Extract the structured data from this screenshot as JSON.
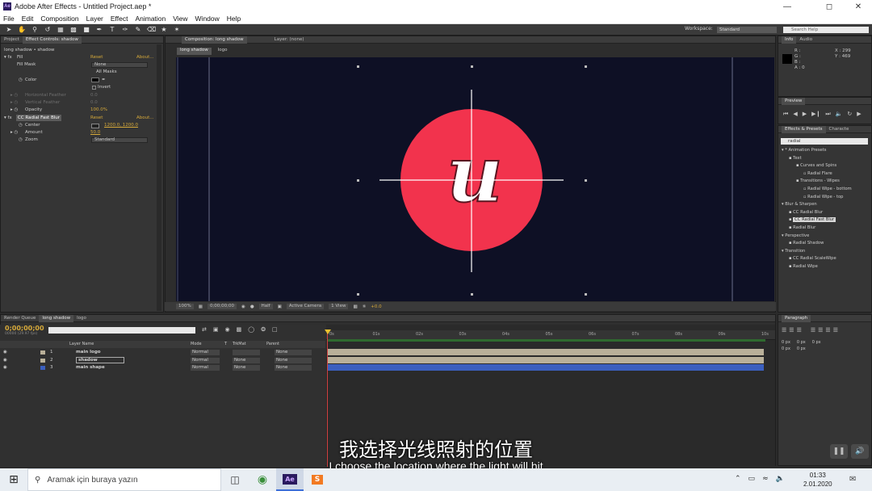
{
  "window": {
    "title": "Adobe After Effects - Untitled Project.aep *",
    "app_badge": "Ae"
  },
  "menu": [
    "File",
    "Edit",
    "Composition",
    "Layer",
    "Effect",
    "Animation",
    "View",
    "Window",
    "Help"
  ],
  "toolbar": {
    "workspace_label": "Workspace:",
    "workspace_value": "Standard",
    "search_placeholder": "Search Help"
  },
  "effect_controls": {
    "tabs": [
      "Project",
      "Effect Controls: shadow"
    ],
    "layer_path": "long shadow • shadow",
    "rows": [
      {
        "name": "Fill",
        "value": "Reset",
        "about": "About..."
      },
      {
        "name": "Fill Mask",
        "dropdown": "None"
      },
      {
        "name": "",
        "option": "All Masks"
      },
      {
        "name": "Color",
        "value": ""
      },
      {
        "name": "",
        "option": "Invert"
      },
      {
        "name": "Horizontal Feather",
        "value": "0.0"
      },
      {
        "name": "Vertical Feather",
        "value": "0.0"
      },
      {
        "name": "Opacity",
        "value": "100.0%"
      },
      {
        "name": "CC Radial Fast Blur",
        "value": "Reset",
        "about": "About..."
      },
      {
        "name": "Center",
        "value": "1200.0, 1200.0"
      },
      {
        "name": "Amount",
        "value": "50.0"
      },
      {
        "name": "Zoom",
        "dropdown": "Standard"
      }
    ]
  },
  "composition": {
    "tabs": [
      "Composition: long shadow",
      "Layer: (none)"
    ],
    "breadcrumbs": [
      "long shadow",
      "logo"
    ],
    "logo_letter": "u",
    "bottom": {
      "zoom": "100%",
      "timecode": "0;00;00;00",
      "resolution": "Half",
      "camera": "Active Camera",
      "view": "1 View",
      "exposure": "+0.0"
    }
  },
  "info": {
    "tabs": [
      "Info",
      "Audio"
    ],
    "r": "R :",
    "g": "G :",
    "b": "B :",
    "a": "A : 0",
    "x": "X : 299",
    "y": "Y : 469"
  },
  "preview": {
    "tab": "Preview"
  },
  "effects_presets": {
    "tabs": [
      "Effects & Presets",
      "Characte"
    ],
    "search_value": "radial",
    "tree": [
      {
        "label": "* Animation Presets",
        "indent": 0
      },
      {
        "label": "Text",
        "indent": 1
      },
      {
        "label": "Curves and Spins",
        "indent": 2
      },
      {
        "label": "Radial Flare",
        "indent": 3
      },
      {
        "label": "Transitions - Wipes",
        "indent": 2
      },
      {
        "label": "Radial Wipe - bottom",
        "indent": 3
      },
      {
        "label": "Radial Wipe - top",
        "indent": 3
      },
      {
        "label": "Blur & Sharpen",
        "indent": 0
      },
      {
        "label": "CC Radial Blur",
        "indent": 1
      },
      {
        "label": "CC Radial Fast Blur",
        "indent": 1,
        "selected": true
      },
      {
        "label": "Radial Blur",
        "indent": 1
      },
      {
        "label": "Perspective",
        "indent": 0
      },
      {
        "label": "Radial Shadow",
        "indent": 1
      },
      {
        "label": "Transition",
        "indent": 0
      },
      {
        "label": "CC Radial ScaleWipe",
        "indent": 1
      },
      {
        "label": "Radial Wipe",
        "indent": 1
      }
    ]
  },
  "timeline": {
    "tabs": [
      "Render Queue",
      "long shadow",
      "logo"
    ],
    "timecode": "0;00;00;00",
    "timecode_sub": "00000 (29.97 fps)",
    "columns": [
      "Layer Name",
      "Mode",
      "T",
      "TrkMat",
      "Parent"
    ],
    "layers": [
      {
        "num": "1",
        "name": "main logo",
        "mode": "Normal",
        "trkmat": "",
        "parent": "None",
        "color": "#b9b099"
      },
      {
        "num": "2",
        "name": "shadow",
        "mode": "Normal",
        "trkmat": "None",
        "parent": "None",
        "color": "#b9b099"
      },
      {
        "num": "3",
        "name": "main shape",
        "mode": "Normal",
        "trkmat": "None",
        "parent": "None",
        "color": "#3b5fbe"
      }
    ],
    "ruler": [
      "0s",
      "01s",
      "02s",
      "03s",
      "04s",
      "05s",
      "06s",
      "07s",
      "08s",
      "09s",
      "10s"
    ]
  },
  "paragraph": {
    "tab": "Paragraph",
    "fields": [
      "0 px",
      "0 px",
      "0 px",
      "0 px",
      "0 px"
    ]
  },
  "subtitles": {
    "zh": "我选择光线照射的位置",
    "en": "I choose the location where the light will hit"
  },
  "taskbar": {
    "search_placeholder": "Aramak için buraya yazın",
    "time": "01:33",
    "date": "2.01.2020"
  },
  "colors": {
    "circle": "#f2334d",
    "comp_bg": "#0e1025",
    "accent": "#d6a93a"
  }
}
